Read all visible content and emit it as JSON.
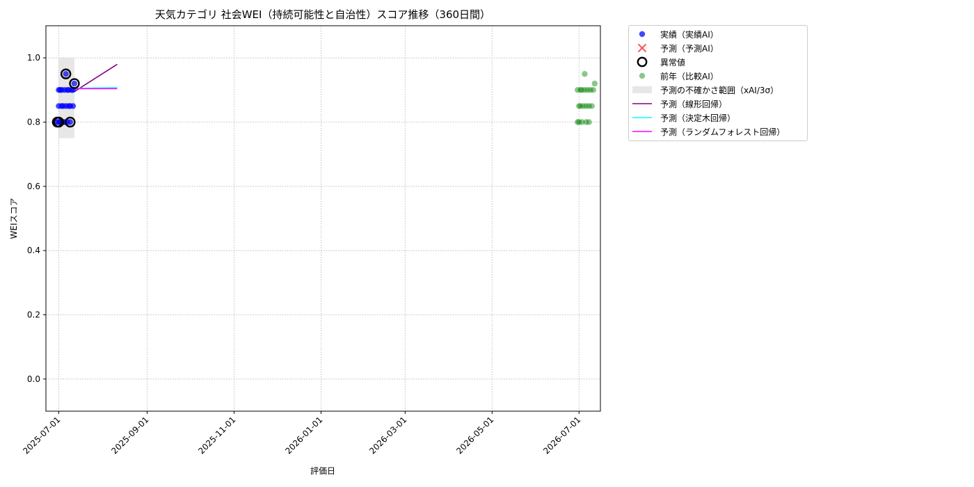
{
  "chart_data": {
    "type": "scatter",
    "title": "天気カテゴリ 社会WEI（持続可能性と自治性）スコア推移（360日間）",
    "xlabel": "評価日",
    "ylabel": "WEIスコア",
    "xlim": [
      "2025-06-22",
      "2026-07-16"
    ],
    "ylim": [
      -0.1,
      1.1
    ],
    "x_ticks": [
      "2025-07-01",
      "2025-09-01",
      "2025-11-01",
      "2026-01-01",
      "2026-03-01",
      "2026-05-01",
      "2026-07-01"
    ],
    "y_ticks": [
      "0.0",
      "0.2",
      "0.4",
      "0.6",
      "0.8",
      "1.0"
    ],
    "grid": true,
    "legend_position": "outside-top-right",
    "series": [
      {
        "name": "実績（実績AI）",
        "kind": "scatter",
        "color": "#0000ff",
        "points": [
          {
            "x": "2025-06-30",
            "y": 0.8
          },
          {
            "x": "2025-07-01",
            "y": 0.8
          },
          {
            "x": "2025-07-01",
            "y": 0.85
          },
          {
            "x": "2025-07-01",
            "y": 0.9
          },
          {
            "x": "2025-07-02",
            "y": 0.9
          },
          {
            "x": "2025-07-02",
            "y": 0.8
          },
          {
            "x": "2025-07-03",
            "y": 0.85
          },
          {
            "x": "2025-07-03",
            "y": 0.9
          },
          {
            "x": "2025-07-04",
            "y": 0.8
          },
          {
            "x": "2025-07-04",
            "y": 0.85
          },
          {
            "x": "2025-07-05",
            "y": 0.9
          },
          {
            "x": "2025-07-05",
            "y": 0.8
          },
          {
            "x": "2025-07-06",
            "y": 0.95
          },
          {
            "x": "2025-07-06",
            "y": 0.85
          },
          {
            "x": "2025-07-07",
            "y": 0.9
          },
          {
            "x": "2025-07-07",
            "y": 0.8
          },
          {
            "x": "2025-07-08",
            "y": 0.85
          },
          {
            "x": "2025-07-08",
            "y": 0.9
          },
          {
            "x": "2025-07-09",
            "y": 0.8
          },
          {
            "x": "2025-07-09",
            "y": 0.85
          },
          {
            "x": "2025-07-10",
            "y": 0.9
          },
          {
            "x": "2025-07-11",
            "y": 0.85
          },
          {
            "x": "2025-07-11",
            "y": 0.9
          },
          {
            "x": "2025-07-12",
            "y": 0.92
          }
        ]
      },
      {
        "name": "予測（予測AI）",
        "kind": "scatter-x",
        "color": "#ff0000",
        "points": []
      },
      {
        "name": "異常値",
        "kind": "ring",
        "color": "#000000",
        "points": [
          {
            "x": "2025-06-30",
            "y": 0.8
          },
          {
            "x": "2025-07-01",
            "y": 0.8
          },
          {
            "x": "2025-07-06",
            "y": 0.95
          },
          {
            "x": "2025-07-09",
            "y": 0.8
          },
          {
            "x": "2025-07-12",
            "y": 0.92
          }
        ]
      },
      {
        "name": "前年（比較AI）",
        "kind": "scatter",
        "color": "#008000",
        "points": [
          {
            "x": "2026-06-30",
            "y": 0.8
          },
          {
            "x": "2026-07-01",
            "y": 0.8
          },
          {
            "x": "2026-07-01",
            "y": 0.85
          },
          {
            "x": "2026-06-30",
            "y": 0.9
          },
          {
            "x": "2026-07-02",
            "y": 0.9
          },
          {
            "x": "2026-07-02",
            "y": 0.85
          },
          {
            "x": "2026-07-03",
            "y": 0.8
          },
          {
            "x": "2026-07-03",
            "y": 0.9
          },
          {
            "x": "2026-07-04",
            "y": 0.85
          },
          {
            "x": "2026-07-05",
            "y": 0.9
          },
          {
            "x": "2026-07-05",
            "y": 0.95
          },
          {
            "x": "2026-07-06",
            "y": 0.8
          },
          {
            "x": "2026-07-06",
            "y": 0.85
          },
          {
            "x": "2026-07-07",
            "y": 0.9
          },
          {
            "x": "2026-07-08",
            "y": 0.8
          },
          {
            "x": "2026-07-08",
            "y": 0.85
          },
          {
            "x": "2026-07-09",
            "y": 0.9
          },
          {
            "x": "2026-07-10",
            "y": 0.85
          },
          {
            "x": "2026-07-11",
            "y": 0.9
          },
          {
            "x": "2026-07-12",
            "y": 0.92
          }
        ]
      },
      {
        "name": "予測の不確かさ範囲（xAI/3σ）",
        "kind": "band",
        "color": "#d3d3d3",
        "x0": "2025-07-01",
        "x1": "2025-07-12",
        "y0": 0.75,
        "y1": 1.0
      },
      {
        "name": "予測（線形回帰）",
        "kind": "line",
        "color": "#800080",
        "points": [
          {
            "x": "2025-07-12",
            "y": 0.895
          },
          {
            "x": "2025-08-11",
            "y": 0.98
          }
        ]
      },
      {
        "name": "予測（決定木回帰）",
        "kind": "line",
        "color": "#00ffff",
        "points": [
          {
            "x": "2025-07-12",
            "y": 0.905
          },
          {
            "x": "2025-08-11",
            "y": 0.907
          }
        ]
      },
      {
        "name": "予測（ランダムフォレスト回帰）",
        "kind": "line",
        "color": "#ff00ff",
        "points": [
          {
            "x": "2025-07-12",
            "y": 0.904
          },
          {
            "x": "2025-08-11",
            "y": 0.904
          }
        ]
      }
    ]
  }
}
